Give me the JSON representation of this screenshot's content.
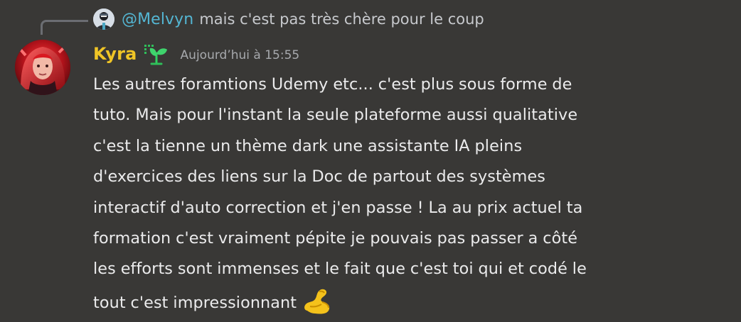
{
  "reply": {
    "mention": "@Melvyn",
    "text": "mais c'est pas très chère pour le coup",
    "avatar_icon": "user-avatar-icon"
  },
  "message": {
    "author": "Kyra",
    "author_color": "#f0c526",
    "role_icon": "sprout-icon",
    "timestamp": "Aujourd’hui à 15:55",
    "lines": [
      "Les autres foramtions Udemy etc... c'est plus sous forme de",
      "tuto. Mais pour l'instant la seule plateforme aussi qualitative",
      "c'est la tienne un thème dark une assistante IA pleins",
      "d'exercices des liens sur la Doc de partout des systèmes",
      "interactif d'auto correction et j'en passe ! La au prix actuel ta",
      "formation c'est vraiment pépite je pouvais pas passer a côté",
      "les efforts sont immenses et le fait que c'est toi qui et codé le",
      "tout c'est impressionnant"
    ],
    "trailing_emoji": "flexed-biceps-emoji"
  },
  "colors": {
    "background": "#393836",
    "mention": "#54b6d3",
    "text": "#ebebec",
    "muted": "#a7a9ad"
  }
}
